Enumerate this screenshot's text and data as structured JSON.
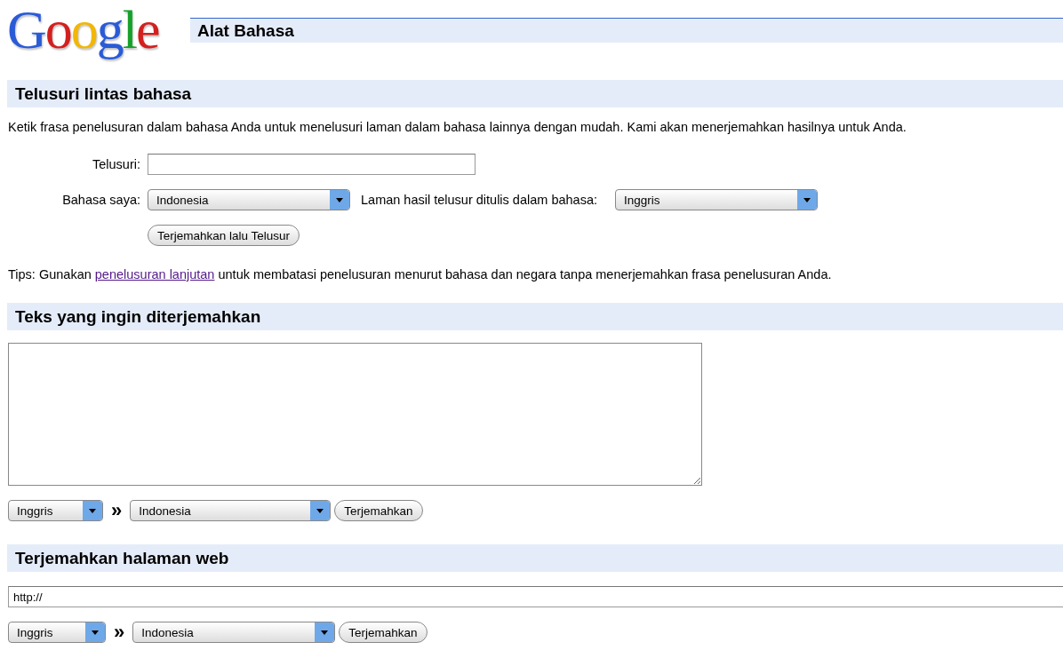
{
  "header": {
    "logo": "Google",
    "title": "Alat Bahasa"
  },
  "search_section": {
    "heading": "Telusuri lintas bahasa",
    "description": "Ketik frasa penelusuran dalam bahasa Anda untuk menelusuri laman dalam bahasa lainnya dengan mudah. Kami akan menerjemahkan hasilnya untuk Anda.",
    "search_label": "Telusuri:",
    "my_language_label": "Bahasa saya:",
    "my_language": "Indonesia",
    "results_language_label": "Laman hasil telusur ditulis dalam bahasa:",
    "results_language": "Inggris",
    "button": "Terjemahkan lalu Telusur",
    "tips": {
      "before": "Tips: Gunakan",
      "link": "penelusuran lanjutan",
      "after": "untuk membatasi penelusuran menurut bahasa dan negara tanpa menerjemahkan frasa penelusuran Anda."
    }
  },
  "text_section": {
    "heading": "Teks yang ingin diterjemahkan",
    "from": "Inggris",
    "separator": "»",
    "to": "Indonesia",
    "button": "Terjemahkan"
  },
  "web_section": {
    "heading": "Terjemahkan halaman web",
    "url": "http://",
    "from": "Inggris",
    "separator": "»",
    "to": "Indonesia",
    "button": "Terjemahkan"
  }
}
